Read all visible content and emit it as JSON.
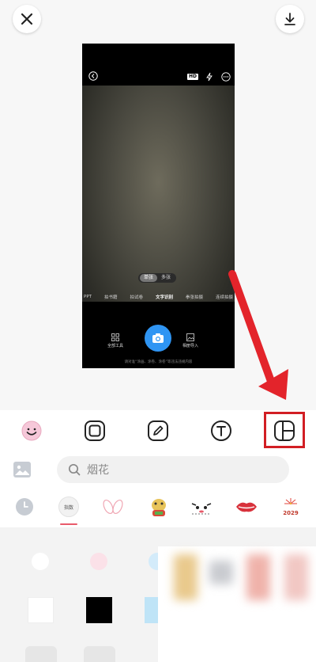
{
  "preview": {
    "hd_badge": "HD",
    "shot_toggle": {
      "single": "单张",
      "multi": "多张",
      "selected": "单张"
    },
    "modes": [
      "PPT",
      "拍书籍",
      "拍试卷",
      "文字识别",
      "拳张拍摄",
      "连续拍摄"
    ],
    "current_mode": "文字识别",
    "tools": {
      "all_tools": "全部工具",
      "import_image": "相册导入"
    },
    "hint": "请对准“涂画、涂卷、涂卷”等违法违规内容"
  },
  "toolbar": {
    "items": [
      {
        "name": "sticker",
        "icon": "smiley-icon"
      },
      {
        "name": "frame",
        "icon": "square-frame-icon"
      },
      {
        "name": "draw",
        "icon": "pencil-icon"
      },
      {
        "name": "text",
        "icon": "text-t-icon"
      },
      {
        "name": "layout",
        "icon": "collage-layout-icon",
        "highlighted": true
      }
    ]
  },
  "stickers": {
    "search_placeholder": "烟花",
    "selected_category_label": "指数",
    "year_label": "2029"
  },
  "colors": {
    "accent_blue": "#2f95f3",
    "highlight_red": "#d21e24",
    "tab_underline": "#e95b6b",
    "swatch_light_blue": "#bfe4f7"
  }
}
